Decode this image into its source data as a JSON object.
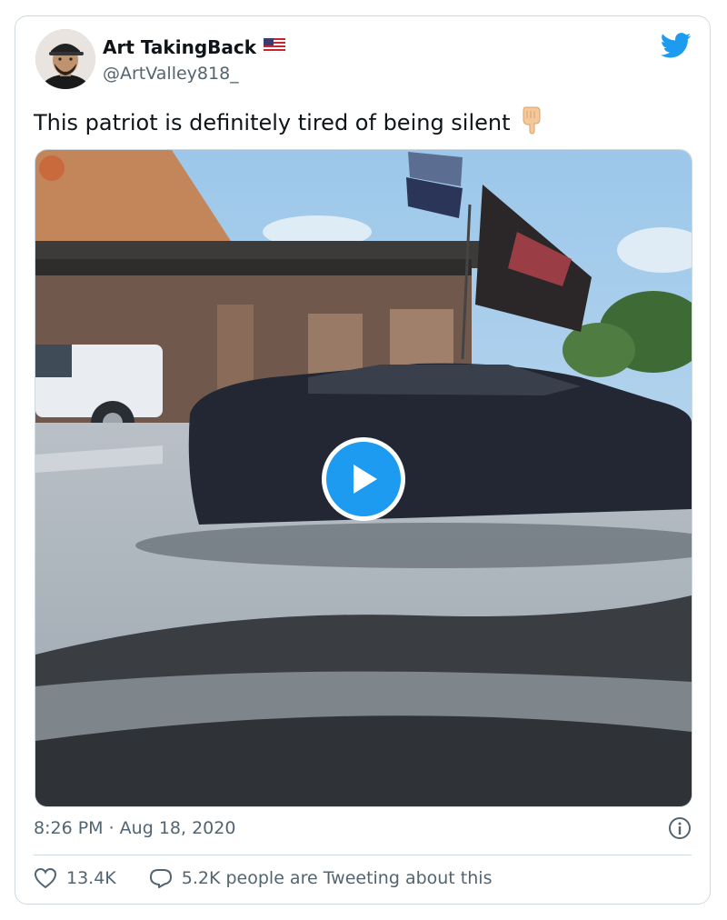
{
  "tweet": {
    "author": {
      "display_name": "Art TakingBack",
      "handle": "@ArtValley818_",
      "flag_icon": "us-flag-icon"
    },
    "text": "This patriot is definitely tired of being silent",
    "text_emoji": "backhand-index-pointing-down-icon",
    "media": {
      "type": "video",
      "play_icon": "play-icon"
    },
    "timestamp": "8:26 PM · Aug 18, 2020",
    "likes": "13.4K",
    "tweeting_about": "5.2K people are Tweeting about this"
  },
  "colors": {
    "accent": "#1d9bf0",
    "secondary_text": "#536471",
    "border": "#cfd9de"
  }
}
